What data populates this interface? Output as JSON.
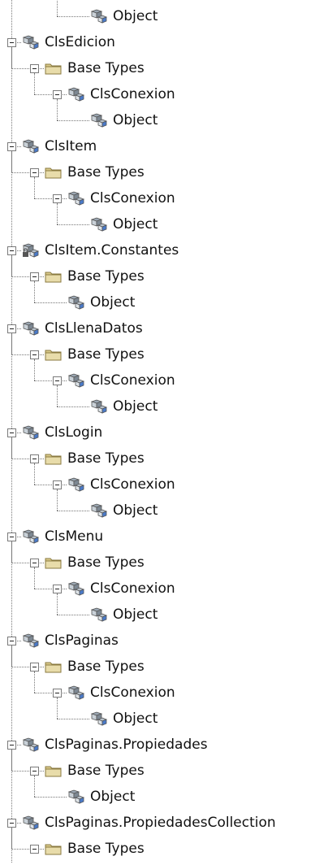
{
  "tree": {
    "rows": [
      {
        "level": 3,
        "kind": "class",
        "label": "Object",
        "toggle": false
      },
      {
        "level": 0,
        "kind": "class",
        "label": "ClsEdicion",
        "toggle": true
      },
      {
        "level": 1,
        "kind": "folder",
        "label": "Base Types",
        "toggle": true
      },
      {
        "level": 2,
        "kind": "class",
        "label": "ClsConexion",
        "toggle": true
      },
      {
        "level": 3,
        "kind": "class",
        "label": "Object",
        "toggle": false
      },
      {
        "level": 0,
        "kind": "class",
        "label": "ClsItem",
        "toggle": true
      },
      {
        "level": 1,
        "kind": "folder",
        "label": "Base Types",
        "toggle": true
      },
      {
        "level": 2,
        "kind": "class",
        "label": "ClsConexion",
        "toggle": true
      },
      {
        "level": 3,
        "kind": "class",
        "label": "Object",
        "toggle": false
      },
      {
        "level": 0,
        "kind": "class-locked",
        "label": "ClsItem.Constantes",
        "toggle": true
      },
      {
        "level": 1,
        "kind": "folder",
        "label": "Base Types",
        "toggle": true
      },
      {
        "level": 2,
        "kind": "class",
        "label": "Object",
        "toggle": false
      },
      {
        "level": 0,
        "kind": "class",
        "label": "ClsLlenaDatos",
        "toggle": true
      },
      {
        "level": 1,
        "kind": "folder",
        "label": "Base Types",
        "toggle": true
      },
      {
        "level": 2,
        "kind": "class",
        "label": "ClsConexion",
        "toggle": true
      },
      {
        "level": 3,
        "kind": "class",
        "label": "Object",
        "toggle": false
      },
      {
        "level": 0,
        "kind": "class",
        "label": "ClsLogin",
        "toggle": true
      },
      {
        "level": 1,
        "kind": "folder",
        "label": "Base Types",
        "toggle": true
      },
      {
        "level": 2,
        "kind": "class",
        "label": "ClsConexion",
        "toggle": true
      },
      {
        "level": 3,
        "kind": "class",
        "label": "Object",
        "toggle": false
      },
      {
        "level": 0,
        "kind": "class",
        "label": "ClsMenu",
        "toggle": true
      },
      {
        "level": 1,
        "kind": "folder",
        "label": "Base Types",
        "toggle": true
      },
      {
        "level": 2,
        "kind": "class",
        "label": "ClsConexion",
        "toggle": true
      },
      {
        "level": 3,
        "kind": "class",
        "label": "Object",
        "toggle": false
      },
      {
        "level": 0,
        "kind": "class",
        "label": "ClsPaginas",
        "toggle": true
      },
      {
        "level": 1,
        "kind": "folder",
        "label": "Base Types",
        "toggle": true
      },
      {
        "level": 2,
        "kind": "class",
        "label": "ClsConexion",
        "toggle": true
      },
      {
        "level": 3,
        "kind": "class",
        "label": "Object",
        "toggle": false
      },
      {
        "level": 0,
        "kind": "class",
        "label": "ClsPaginas.Propiedades",
        "toggle": true
      },
      {
        "level": 1,
        "kind": "folder",
        "label": "Base Types",
        "toggle": true
      },
      {
        "level": 2,
        "kind": "class",
        "label": "Object",
        "toggle": false
      },
      {
        "level": 0,
        "kind": "class",
        "label": "ClsPaginas.PropiedadesCollection",
        "toggle": true
      },
      {
        "level": 1,
        "kind": "folder",
        "label": "Base Types",
        "toggle": true
      }
    ]
  },
  "icons": {
    "class": "class-icon",
    "class-locked": "class-locked-icon",
    "folder": "folder-icon"
  },
  "colors": {
    "folder": "#d9c98a",
    "class": "#9aa6b2",
    "accent": "#4a7ac8",
    "lines": "#777777"
  }
}
